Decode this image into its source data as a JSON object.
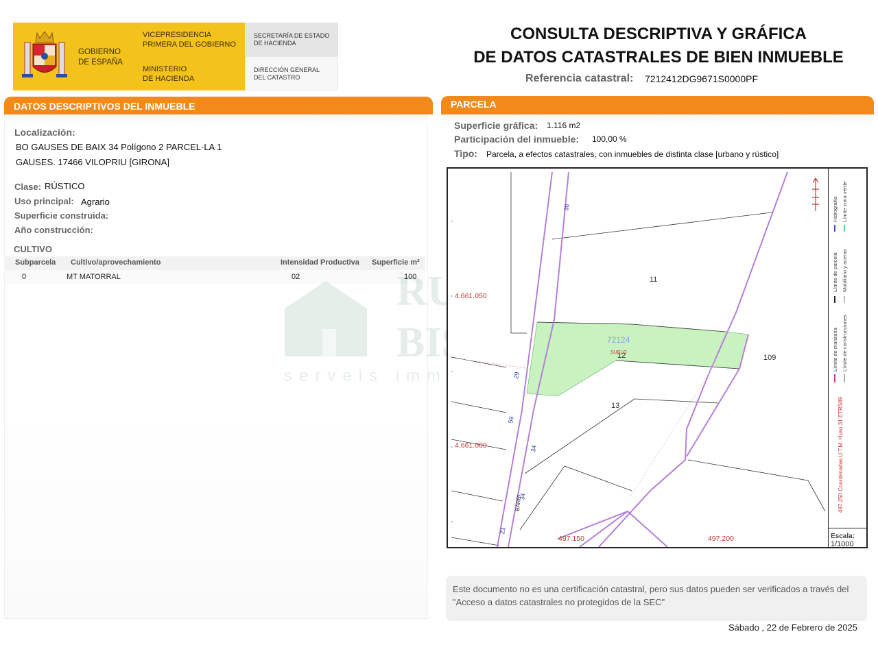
{
  "header": {
    "gobierno": [
      "GOBIERNO",
      "DE ESPAÑA"
    ],
    "vicepresidencia": [
      "VICEPRESIDENCIA",
      "PRIMERA DEL GOBIERNO"
    ],
    "ministerio": [
      "MINISTERIO",
      "DE HACIENDA"
    ],
    "secretaria": [
      "SECRETARÍA DE ESTADO",
      "DE HACIENDA"
    ],
    "direccion": [
      "DIRECCIÓN GENERAL",
      "DEL CATASTRO"
    ],
    "title_line1": "CONSULTA DESCRIPTIVA Y GRÁFICA",
    "title_line2": "DE DATOS CATASTRALES DE BIEN INMUEBLE",
    "ref_label": "Referencia catastral:",
    "ref_value": "7212412DG9671S0000PF"
  },
  "left": {
    "section_title": "DATOS DESCRIPTIVOS DEL INMUEBLE",
    "localizacion_label": "Localización:",
    "localizacion_line1": "BO GAUSES DE BAIX 34 Polígono 2 PARCEL·LA  1",
    "localizacion_line2": "GAUSES. 17466 VILOPRIU [GIRONA]",
    "clase_label": "Clase:",
    "clase_value": "RÚSTICO",
    "uso_label": "Uso principal:",
    "uso_value": "Agrario",
    "superficie_label": "Superficie construida:",
    "anio_label": "Año construcción:",
    "cultivo_title": "CULTIVO",
    "cultivo_columns": [
      "Subparcela",
      "Cultivo/aprovechamiento",
      "Intensidad Productiva",
      "Superficie m²"
    ],
    "cultivo_rows": [
      [
        "0",
        "MT MATORRAL",
        "02",
        "100"
      ]
    ]
  },
  "right": {
    "section_title": "PARCELA",
    "sup_label": "Superficie gráfica:",
    "sup_value": "1.116 m2",
    "part_label": "Participación del inmueble:",
    "part_value": "100,00 %",
    "tipo_label": "Tipo:",
    "tipo_value": "Parcela, a efectos catastrales, con inmuebles de distinta clase [urbano y rústico]"
  },
  "map": {
    "y_coord_1": "4.661.050",
    "y_coord_2": "4.661.000",
    "x_coord_1": "497.150",
    "x_coord_2": "497.200",
    "parcel_id": "72124",
    "parcel_sub": "SUELO",
    "labels": [
      "11",
      "12",
      "13",
      "109"
    ],
    "road_labels": [
      "36",
      "29",
      "59",
      "34",
      "34",
      "23"
    ],
    "barri": "BARRI",
    "legend": [
      "Hidrografía",
      "Límite zona verde",
      "Límite de parcela",
      "Mobiliario y aceras",
      "Límite de manzana",
      "Límite de construcciones"
    ],
    "utm": "497.250 Coordenadas U.T.M. Huso 31 ETRS89",
    "escala_label": "Escala:",
    "escala_value": "1/1000"
  },
  "watermark": {
    "line1": "RUSTIC",
    "line2": "BISBAL",
    "line3": "serveis immobiliaris"
  },
  "footer": {
    "notice": "Este documento no es una certificación catastral, pero sus datos pueden ser verificados a través del \"Acceso a datos catastrales no protegidos de la SEC\"",
    "date": "Sábado , 22 de Febrero de 2025"
  },
  "colors": {
    "orange": "#f28a1a",
    "gold": "#f3c21b",
    "parcel_fill": "#c8f2c0",
    "road": "#b57fd9"
  }
}
